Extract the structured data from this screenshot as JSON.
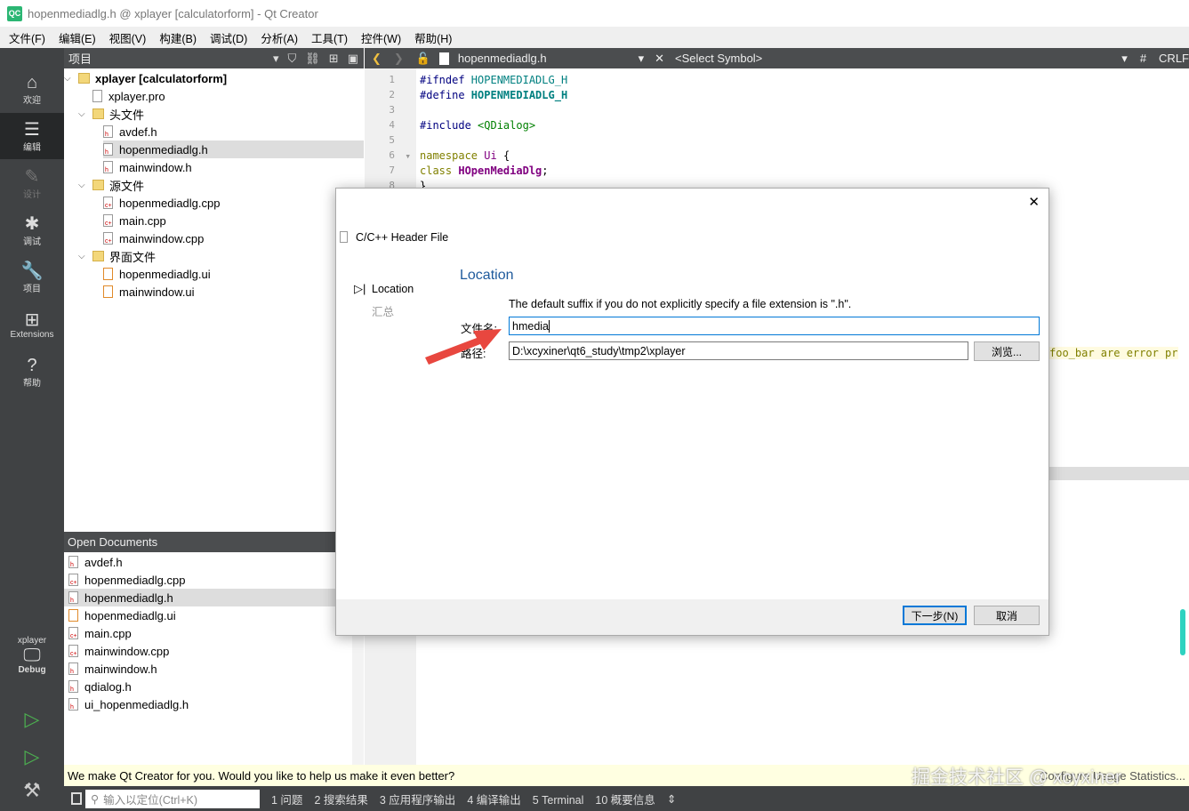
{
  "window": {
    "title": "hopenmediadlg.h @ xplayer [calculatorform] - Qt Creator",
    "logo": "QC"
  },
  "menu": [
    "文件(F)",
    "编辑(E)",
    "视图(V)",
    "构建(B)",
    "调试(D)",
    "分析(A)",
    "工具(T)",
    "控件(W)",
    "帮助(H)"
  ],
  "modes": [
    {
      "label": "欢迎",
      "icon": "home-icon"
    },
    {
      "label": "编辑",
      "icon": "edit-icon"
    },
    {
      "label": "设计",
      "icon": "pen-icon"
    },
    {
      "label": "调试",
      "icon": "bug-icon"
    },
    {
      "label": "项目",
      "icon": "wrench-icon"
    },
    {
      "label": "Extensions",
      "icon": "extensions-icon"
    },
    {
      "label": "帮助",
      "icon": "help-icon"
    }
  ],
  "kit": {
    "project": "xplayer",
    "config": "Debug"
  },
  "projects": {
    "header": "项目",
    "tree": [
      {
        "label": "xplayer [calculatorform]",
        "level": 0,
        "type": "project",
        "bold": true
      },
      {
        "label": "xplayer.pro",
        "level": 1,
        "type": "pro"
      },
      {
        "label": "头文件",
        "level": 1,
        "type": "folder"
      },
      {
        "label": "avdef.h",
        "level": 2,
        "type": "h"
      },
      {
        "label": "hopenmediadlg.h",
        "level": 2,
        "type": "h",
        "selected": true
      },
      {
        "label": "mainwindow.h",
        "level": 2,
        "type": "h"
      },
      {
        "label": "源文件",
        "level": 1,
        "type": "folder"
      },
      {
        "label": "hopenmediadlg.cpp",
        "level": 2,
        "type": "cpp"
      },
      {
        "label": "main.cpp",
        "level": 2,
        "type": "cpp"
      },
      {
        "label": "mainwindow.cpp",
        "level": 2,
        "type": "cpp"
      },
      {
        "label": "界面文件",
        "level": 1,
        "type": "folder"
      },
      {
        "label": "hopenmediadlg.ui",
        "level": 2,
        "type": "ui"
      },
      {
        "label": "mainwindow.ui",
        "level": 2,
        "type": "ui"
      }
    ]
  },
  "open_documents": {
    "header": "Open Documents",
    "items": [
      {
        "label": "avdef.h",
        "type": "h"
      },
      {
        "label": "hopenmediadlg.cpp",
        "type": "cpp"
      },
      {
        "label": "hopenmediadlg.h",
        "type": "h",
        "selected": true
      },
      {
        "label": "hopenmediadlg.ui",
        "type": "ui"
      },
      {
        "label": "main.cpp",
        "type": "cpp"
      },
      {
        "label": "mainwindow.cpp",
        "type": "cpp"
      },
      {
        "label": "mainwindow.h",
        "type": "h"
      },
      {
        "label": "qdialog.h",
        "type": "h"
      },
      {
        "label": "ui_hopenmediadlg.h",
        "type": "h"
      }
    ]
  },
  "editor": {
    "file": "hopenmediadlg.h",
    "symbol": "<Select Symbol>",
    "hash": "#",
    "line_ending": "CRLF",
    "lines": [
      {
        "n": "1",
        "parts": [
          [
            "#ifndef ",
            "#000080"
          ],
          [
            "HOPENMEDIADLG_H",
            "#008080"
          ]
        ]
      },
      {
        "n": "2",
        "parts": [
          [
            "#define ",
            "#000080"
          ],
          [
            "HOPENMEDIADLG_H",
            "#008080"
          ]
        ]
      },
      {
        "n": "3",
        "parts": []
      },
      {
        "n": "4",
        "parts": [
          [
            "#include ",
            "#000080"
          ],
          [
            "<QDialog>",
            "#008000"
          ]
        ]
      },
      {
        "n": "5",
        "parts": []
      },
      {
        "n": "6",
        "parts": [
          [
            "namespace ",
            "#808000"
          ],
          [
            "Ui ",
            "#800080"
          ],
          [
            "{",
            "#000"
          ]
        ]
      },
      {
        "n": "7",
        "parts": [
          [
            "class ",
            "#808000"
          ],
          [
            "HOpenMediaDlg",
            "#800080"
          ],
          [
            ";",
            "#000"
          ]
        ]
      },
      {
        "n": "8",
        "parts": [
          [
            "}",
            "#000"
          ]
        ]
      }
    ],
    "fragment": "foo_bar are error pr"
  },
  "dialog": {
    "title": "C/C++ Header File",
    "steps": [
      "Location",
      "汇总"
    ],
    "section": "Location",
    "hint": "The default suffix if you do not explicitly specify a file extension is \".h\".",
    "filename_label": "文件名:",
    "filename": "hmedia",
    "path_label": "路径:",
    "path": "D:\\xcyxiner\\qt6_study\\tmp2\\xplayer",
    "browse": "浏览...",
    "next": "下一步(N)",
    "cancel": "取消",
    "close": "✕"
  },
  "notification": "We make Qt Creator for you. Would you like to help us make it even better?",
  "notification_right": "Configure Usage Statistics...",
  "watermark": "掘金技术社区 @ xcyxiner",
  "status": {
    "locator_placeholder": "输入以定位(Ctrl+K)",
    "panes": [
      "1 问题",
      "2 搜索结果",
      "3 应用程序输出",
      "4 编译输出",
      "5 Terminal",
      "10 概要信息"
    ]
  },
  "colors": {
    "accent": "#2bb673",
    "mode_bar": "#404244",
    "dialog_heading": "#1e5a9c",
    "arrow": "#e8473f"
  }
}
